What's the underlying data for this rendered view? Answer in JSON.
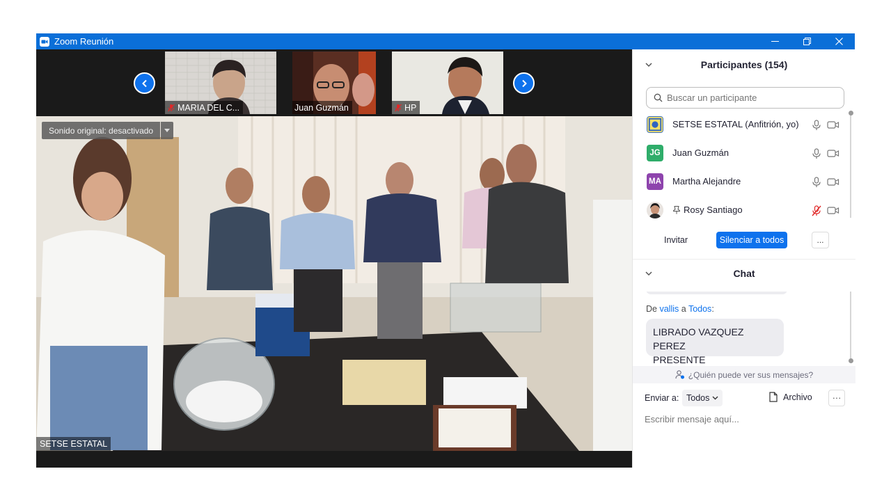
{
  "window": {
    "title": "Zoom Reunión"
  },
  "colors": {
    "titlebar": "#0b6fd8",
    "accent": "#0e72ed",
    "muted_mic": "#e02828",
    "avatar_jg": "#2fad6a",
    "avatar_ma": "#8e44ad"
  },
  "thumbnails": [
    {
      "name": "MARIA DEL C...",
      "muted": true
    },
    {
      "name": "Juan Guzmán",
      "muted": false
    },
    {
      "name": "HP",
      "muted": true
    }
  ],
  "main_video": {
    "audio_label": "Sonido original: desactivado",
    "speaker_name": "SETSE ESTATAL"
  },
  "participants": {
    "header": "Participantes (154)",
    "search_placeholder": "Buscar un participante",
    "list": [
      {
        "name": "SETSE ESTATAL (Anfitrión, yo)",
        "avatar_initials": "",
        "avatar_type": "image",
        "mic": "on",
        "video": "off"
      },
      {
        "name": "Juan Guzmán",
        "avatar_initials": "JG",
        "avatar_type": "initials",
        "mic": "on",
        "video": "off"
      },
      {
        "name": "Martha Alejandre",
        "avatar_initials": "MA",
        "avatar_type": "initials",
        "mic": "on",
        "video": "off"
      },
      {
        "name": "Rosy Santiago",
        "avatar_initials": "",
        "avatar_type": "image",
        "mic": "muted",
        "video": "off",
        "pinned_icon": "pin-icon"
      }
    ],
    "invite_label": "Invitar",
    "mute_all_label": "Silenciar a todos",
    "more_label": "..."
  },
  "chat": {
    "header": "Chat",
    "message": {
      "from_prefix": "De",
      "sender": "vallis",
      "to_word": "a",
      "recipient": "Todos",
      "suffix": ":",
      "text_line1": "LIBRADO VAZQUEZ PEREZ",
      "text_line2": "PRESENTE"
    },
    "who_can_see": "¿Quién puede ver sus mensajes?",
    "send_to_label": "Enviar a:",
    "send_to_value": "Todos",
    "file_label": "Archivo",
    "more_label": "···",
    "input_placeholder": "Escribir mensaje aquí..."
  }
}
